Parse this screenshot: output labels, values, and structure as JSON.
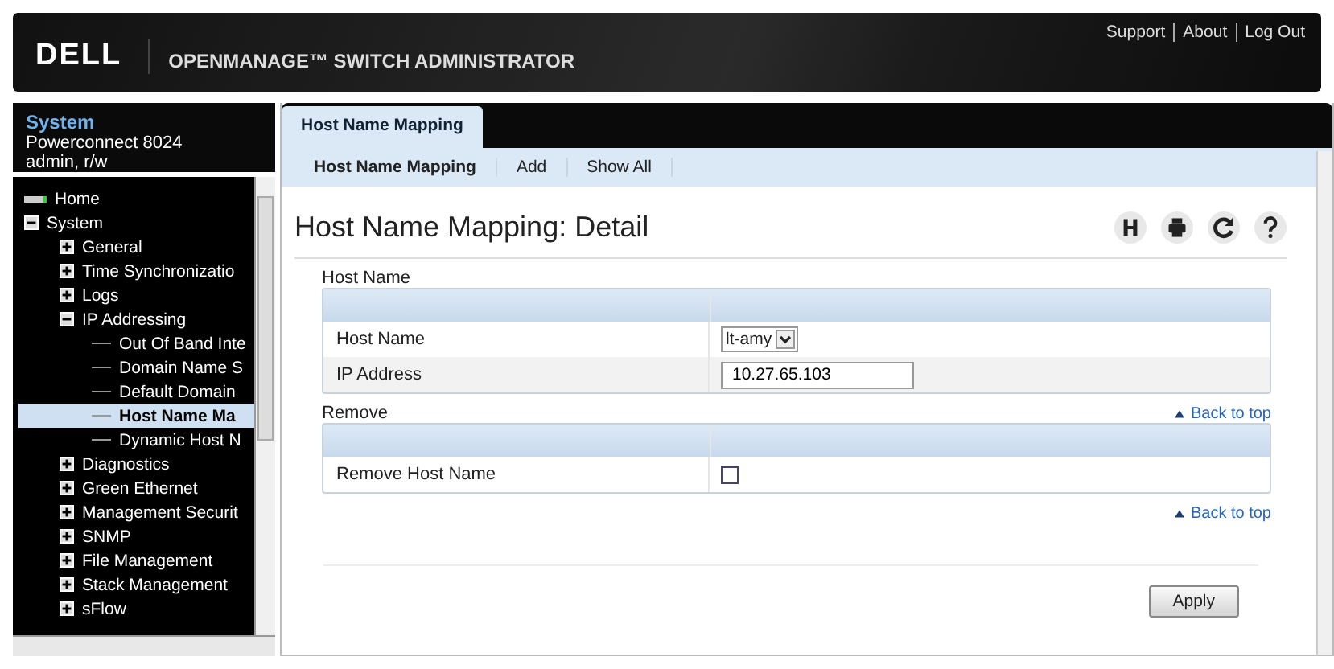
{
  "header": {
    "logo": "DELL",
    "title": "OPENMANAGE™ SWITCH ADMINISTRATOR",
    "links": [
      "Support",
      "About",
      "Log Out"
    ]
  },
  "sidebar": {
    "title": "System",
    "device": "Powerconnect 8024",
    "user": "admin, r/w",
    "tree": [
      {
        "label": "Home",
        "kind": "home",
        "selected": false
      },
      {
        "label": "System",
        "kind": "folder",
        "expanded": true,
        "selected": false,
        "children": [
          {
            "label": "General",
            "kind": "folder",
            "expanded": false,
            "selected": false
          },
          {
            "label": "Time Synchronizatio",
            "kind": "folder",
            "expanded": false,
            "selected": false
          },
          {
            "label": "Logs",
            "kind": "folder",
            "expanded": false,
            "selected": false
          },
          {
            "label": "IP Addressing",
            "kind": "folder",
            "expanded": true,
            "selected": false,
            "children": [
              {
                "label": "Out Of Band Inte",
                "kind": "leaf",
                "selected": false
              },
              {
                "label": "Domain Name S",
                "kind": "leaf",
                "selected": false
              },
              {
                "label": "Default Domain",
                "kind": "leaf",
                "selected": false
              },
              {
                "label": "Host Name Ma",
                "kind": "leaf",
                "selected": true
              },
              {
                "label": "Dynamic Host N",
                "kind": "leaf",
                "selected": false
              }
            ]
          },
          {
            "label": "Diagnostics",
            "kind": "folder",
            "expanded": false,
            "selected": false
          },
          {
            "label": "Green Ethernet",
            "kind": "folder",
            "expanded": false,
            "selected": false
          },
          {
            "label": "Management Securit",
            "kind": "folder",
            "expanded": false,
            "selected": false
          },
          {
            "label": "SNMP",
            "kind": "folder",
            "expanded": false,
            "selected": false
          },
          {
            "label": "File Management",
            "kind": "folder",
            "expanded": false,
            "selected": false
          },
          {
            "label": "Stack Management",
            "kind": "folder",
            "expanded": false,
            "selected": false
          },
          {
            "label": "sFlow",
            "kind": "folder",
            "expanded": false,
            "selected": false
          }
        ]
      }
    ]
  },
  "tabs": [
    {
      "label": "Host Name Mapping",
      "selected": true
    }
  ],
  "subnav": [
    {
      "label": "Host Name Mapping",
      "selected": true
    },
    {
      "label": "Add",
      "selected": false
    },
    {
      "label": "Show All",
      "selected": false
    }
  ],
  "page_title": "Host Name Mapping: Detail",
  "sections": [
    {
      "title": "Host Name",
      "rows": [
        {
          "label": "Host Name",
          "kind": "select",
          "value": "lt-amy"
        },
        {
          "label": "IP Address",
          "kind": "text",
          "value": "10.27.65.103"
        }
      ]
    },
    {
      "title": "Remove",
      "back_link": "Back to top",
      "rows": [
        {
          "label": "Remove Host Name",
          "kind": "checkbox",
          "checked": false
        }
      ]
    }
  ],
  "footer_link": "Back to top",
  "apply_button": "Apply"
}
